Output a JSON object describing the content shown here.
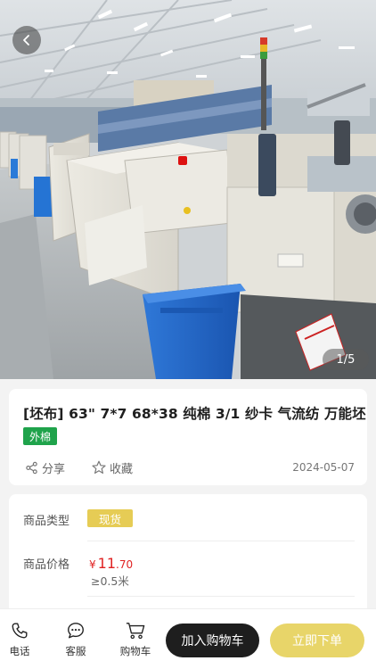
{
  "hero": {
    "pager": "1/5"
  },
  "product": {
    "title": "[坯布] 63\" 7*7 68*38 纯棉 3/1 纱卡 气流纺 万能坯",
    "tag": "外棉",
    "share_label": "分享",
    "favorite_label": "收藏",
    "date": "2024-05-07"
  },
  "details": {
    "type_label": "商品类型",
    "type_value": "现货",
    "price_label": "商品价格",
    "price_symbol": "¥",
    "price_int": "11",
    "price_dec": ".70",
    "moq": "≥0.5米"
  },
  "bottom_bar": {
    "phone_label": "电话",
    "service_label": "客服",
    "cart_label": "购物车",
    "add_to_cart": "加入购物车",
    "buy_now": "立即下单"
  },
  "colors": {
    "tag_green": "#1fa34b",
    "type_yellow": "#e6cc55",
    "price_red": "#e02222",
    "buy_button": "#e8d569",
    "cart_button": "#1e1e1e"
  }
}
